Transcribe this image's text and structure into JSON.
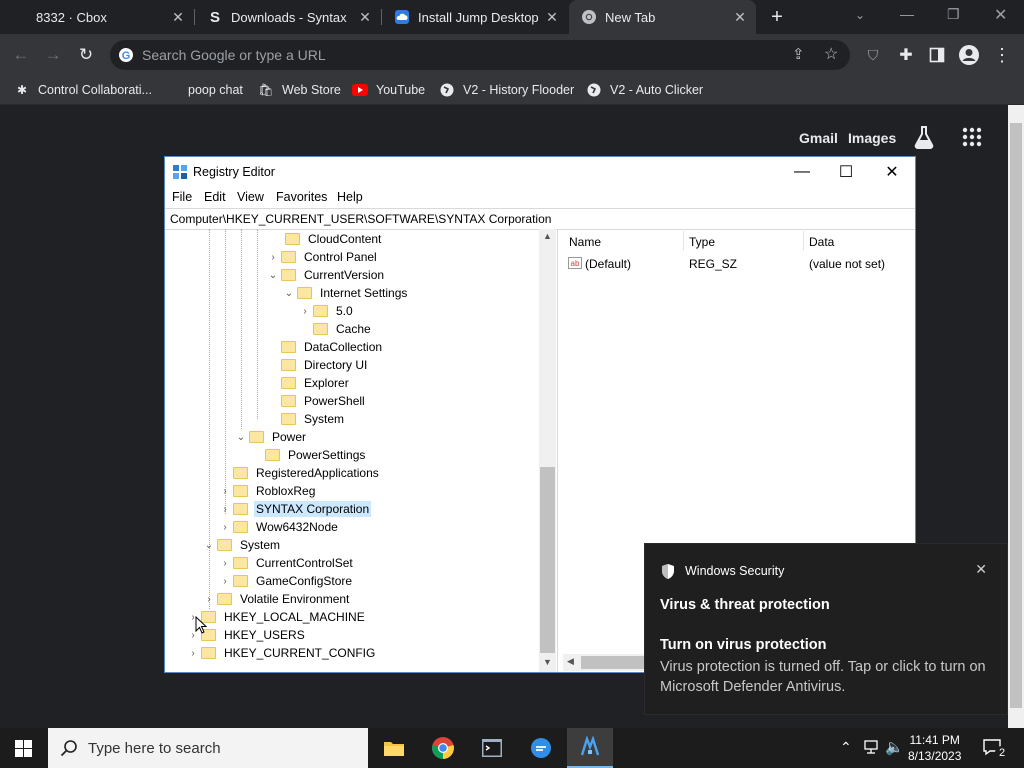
{
  "browser": {
    "tabs": [
      {
        "label": "8332 · Cbox",
        "active": false
      },
      {
        "label": "Downloads - Syntax",
        "active": false
      },
      {
        "label": "Install Jump Desktop C",
        "active": false
      },
      {
        "label": "New Tab",
        "active": true
      }
    ],
    "omnibox_placeholder": "Search Google or type a URL",
    "bookmarks": [
      "Control Collaborati...",
      "poop chat",
      "Web Store",
      "YouTube",
      "V2 - History Flooder",
      "V2 - Auto Clicker"
    ],
    "ntp_links": {
      "gmail": "Gmail",
      "images": "Images"
    }
  },
  "regedit": {
    "title": "Registry Editor",
    "menu": [
      "File",
      "Edit",
      "View",
      "Favorites",
      "Help"
    ],
    "address": "Computer\\HKEY_CURRENT_USER\\SOFTWARE\\SYNTAX Corporation",
    "tree": [
      {
        "label": "CloudContent"
      },
      {
        "label": "Control Panel"
      },
      {
        "label": "CurrentVersion"
      },
      {
        "label": "Internet Settings"
      },
      {
        "label": "5.0"
      },
      {
        "label": "Cache"
      },
      {
        "label": "DataCollection"
      },
      {
        "label": "Directory UI"
      },
      {
        "label": "Explorer"
      },
      {
        "label": "PowerShell"
      },
      {
        "label": "System"
      },
      {
        "label": "Power"
      },
      {
        "label": "PowerSettings"
      },
      {
        "label": "RegisteredApplications"
      },
      {
        "label": "RobloxReg"
      },
      {
        "label": "SYNTAX Corporation"
      },
      {
        "label": "Wow6432Node"
      },
      {
        "label": "System"
      },
      {
        "label": "CurrentControlSet"
      },
      {
        "label": "GameConfigStore"
      },
      {
        "label": "Volatile Environment"
      },
      {
        "label": "HKEY_LOCAL_MACHINE"
      },
      {
        "label": "HKEY_USERS"
      },
      {
        "label": "HKEY_CURRENT_CONFIG"
      }
    ],
    "columns": [
      "Name",
      "Type",
      "Data"
    ],
    "rows": [
      {
        "name": "(Default)",
        "type": "REG_SZ",
        "data": "(value not set)"
      }
    ]
  },
  "toast": {
    "app": "Windows Security",
    "title": "Virus & threat protection",
    "heading": "Turn on virus protection",
    "body": "Virus protection is turned off. Tap or click to turn on Microsoft Defender Antivirus."
  },
  "taskbar": {
    "search_placeholder": "Type here to search",
    "time": "11:41 PM",
    "date": "8/13/2023",
    "notification_count": "2"
  }
}
